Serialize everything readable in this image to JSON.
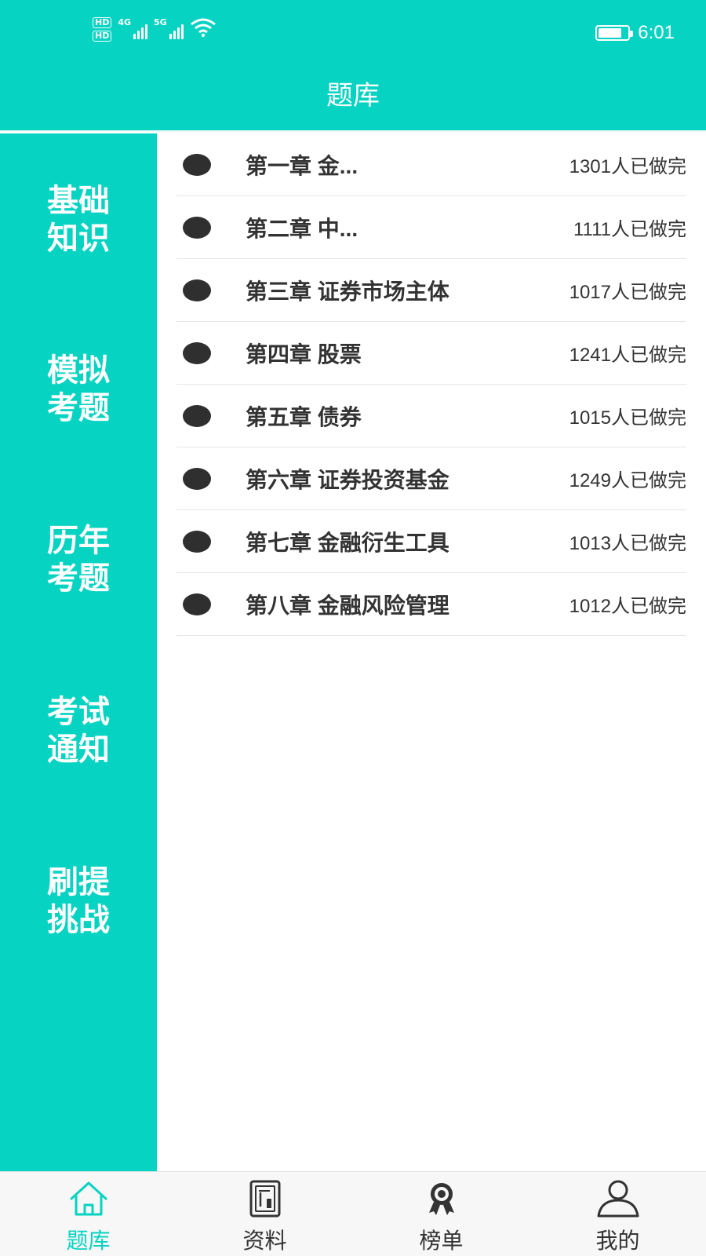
{
  "status_bar": {
    "hd1": "HD",
    "hd2": "HD",
    "net1": "4G",
    "net2": "5G",
    "time": "6:01",
    "icons": [
      "hd-icon",
      "signal-icon",
      "signal-icon",
      "wifi-icon",
      "battery-icon"
    ]
  },
  "header": {
    "title": "题库"
  },
  "sidebar": {
    "items": [
      {
        "line1": "基础",
        "line2": "知识"
      },
      {
        "line1": "模拟",
        "line2": "考题"
      },
      {
        "line1": "历年",
        "line2": "考题"
      },
      {
        "line1": "考试",
        "line2": "通知"
      },
      {
        "line1": "刷提",
        "line2": "挑战"
      }
    ]
  },
  "chapters": [
    {
      "title": "第一章 金...",
      "count": "1301人已做完"
    },
    {
      "title": "第二章 中...",
      "count": "1111人已做完"
    },
    {
      "title": "第三章 证券市场主体",
      "count": "1017人已做完"
    },
    {
      "title": "第四章 股票",
      "count": "1241人已做完"
    },
    {
      "title": "第五章 债券",
      "count": "1015人已做完"
    },
    {
      "title": "第六章 证券投资基金",
      "count": "1249人已做完"
    },
    {
      "title": "第七章 金融衍生工具",
      "count": "1013人已做完"
    },
    {
      "title": "第八章 金融风险管理",
      "count": "1012人已做完"
    }
  ],
  "bottom_nav": {
    "items": [
      {
        "label": "题库",
        "icon": "home-icon",
        "active": true
      },
      {
        "label": "资料",
        "icon": "document-icon",
        "active": false
      },
      {
        "label": "榜单",
        "icon": "award-icon",
        "active": false
      },
      {
        "label": "我的",
        "icon": "user-icon",
        "active": false
      }
    ]
  },
  "colors": {
    "accent": "#06D3C2",
    "dot": "#2f2f2f",
    "text": "#333333"
  }
}
